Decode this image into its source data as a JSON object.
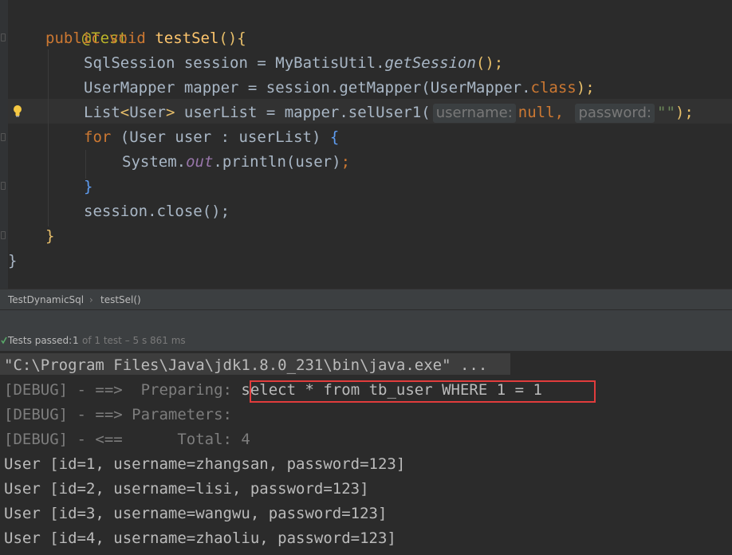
{
  "editor": {
    "annotation": "@Test",
    "method_sig": {
      "kw1": "public",
      "kw2": "void",
      "name": "testSel",
      "paren": "()",
      "brace": "{"
    },
    "line3": {
      "type": "SqlSession",
      "var": "session",
      "eq": " = ",
      "cls": "MyBatisUtil.",
      "call": "getSession",
      "tail": "();"
    },
    "line4": {
      "type": "UserMapper",
      "var": "mapper",
      "rest1": " = session.getMapper(",
      "arg": "UserMapper.",
      "kw": "class",
      "tail": ");"
    },
    "line5": {
      "type": "List",
      "lt": "<",
      "generic": "User",
      "gt": ">",
      "var": " userList = mapper.selUser1(",
      "hint1": "username:",
      "null_kw": "null",
      "comma": ",",
      "hint2": "password:",
      "str": "\"\"",
      "tail": ");"
    },
    "line6": {
      "kw": "for",
      "rest": " (User user : userList) ",
      "brace": "{"
    },
    "line7": {
      "cls": "System.",
      "field": "out",
      "rest": ".println(user)",
      "semi": ";"
    },
    "line8": {
      "brace": "}"
    },
    "line9": {
      "text": "session.close();"
    },
    "line10": {
      "brace": "}"
    },
    "line11": {
      "brace": "}"
    }
  },
  "breadcrumb": {
    "class_name": "TestDynamicSql",
    "sep": "›",
    "method_name": "testSel()"
  },
  "test_status": {
    "label": "Tests passed:",
    "count": "1",
    "detail": "of 1 test – 5 s 861 ms"
  },
  "console": {
    "cmd": "\"C:\\Program Files\\Java\\jdk1.8.0_231\\bin\\java.exe\" ...",
    "prep_prefix": "[DEBUG] - ==>  Preparing: ",
    "prep_sql": "select * from tb_user WHERE 1 = 1",
    "params": "[DEBUG] - ==> Parameters: ",
    "total": "[DEBUG] - <==      Total: 4",
    "users": [
      "User [id=1, username=zhangsan, password=123]",
      "User [id=2, username=lisi, password=123]",
      "User [id=3, username=wangwu, password=123]",
      "User [id=4, username=zhaoliu, password=123]"
    ]
  },
  "colors": {
    "keyword": "#cc7832",
    "method": "#ffc66d",
    "highlight_box": "#e13c3c",
    "test_pass": "#59a869"
  }
}
